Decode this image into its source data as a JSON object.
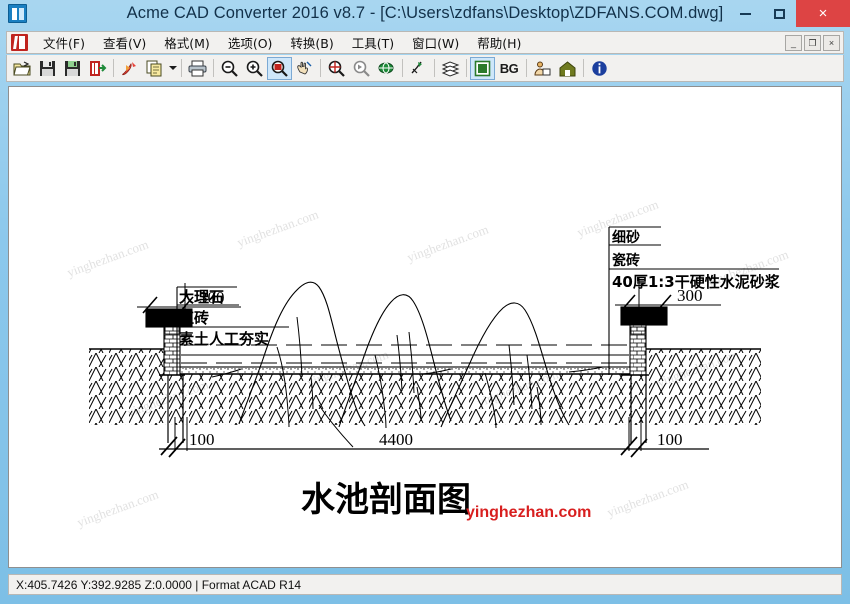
{
  "window": {
    "title": "Acme CAD Converter 2016 v8.7 - [C:\\Users\\zdfans\\Desktop\\ZDFANS.COM.dwg]",
    "icon": "app-icon",
    "buttons": {
      "minimize": "minimize",
      "maximize": "maximize",
      "close": "×"
    }
  },
  "menubar": {
    "logo": "acme-logo",
    "items": [
      {
        "label": "文件(F)",
        "name": "file"
      },
      {
        "label": "查看(V)",
        "name": "view"
      },
      {
        "label": "格式(M)",
        "name": "format"
      },
      {
        "label": "选项(O)",
        "name": "options"
      },
      {
        "label": "转换(B)",
        "name": "convert"
      },
      {
        "label": "工具(T)",
        "name": "tools"
      },
      {
        "label": "窗口(W)",
        "name": "window"
      },
      {
        "label": "帮助(H)",
        "name": "help"
      }
    ],
    "mdi_buttons": [
      "_",
      "❐",
      "×"
    ]
  },
  "toolbar": {
    "items": [
      {
        "name": "open-icon",
        "kind": "icon"
      },
      {
        "name": "save-icon",
        "kind": "icon"
      },
      {
        "name": "save-as-icon",
        "kind": "icon"
      },
      {
        "name": "batch-convert-icon",
        "kind": "icon"
      },
      {
        "name": "separator",
        "kind": "sep"
      },
      {
        "name": "pdf-export-icon",
        "kind": "icon"
      },
      {
        "name": "copy-icon",
        "kind": "icon"
      },
      {
        "name": "dropdown-arrow-icon",
        "kind": "arrow"
      },
      {
        "name": "separator",
        "kind": "sep"
      },
      {
        "name": "print-icon",
        "kind": "icon"
      },
      {
        "name": "separator",
        "kind": "sep"
      },
      {
        "name": "zoom-out-icon",
        "kind": "icon"
      },
      {
        "name": "zoom-in-icon",
        "kind": "icon"
      },
      {
        "name": "zoom-window-icon",
        "kind": "icon",
        "active": true
      },
      {
        "name": "pan-icon",
        "kind": "icon"
      },
      {
        "name": "separator",
        "kind": "sep"
      },
      {
        "name": "zoom-extents-icon",
        "kind": "icon"
      },
      {
        "name": "zoom-previous-icon",
        "kind": "icon"
      },
      {
        "name": "zoom-all-icon",
        "kind": "icon"
      },
      {
        "name": "separator",
        "kind": "sep"
      },
      {
        "name": "measure-icon",
        "kind": "icon"
      },
      {
        "name": "separator",
        "kind": "sep"
      },
      {
        "name": "layers-icon",
        "kind": "icon"
      },
      {
        "name": "separator",
        "kind": "sep"
      },
      {
        "name": "display-mode-icon",
        "kind": "icon",
        "active": true
      },
      {
        "name": "background-toggle",
        "kind": "text",
        "label": "BG"
      },
      {
        "name": "separator",
        "kind": "sep"
      },
      {
        "name": "register-icon",
        "kind": "icon"
      },
      {
        "name": "home-icon",
        "kind": "icon"
      },
      {
        "name": "separator",
        "kind": "sep"
      },
      {
        "name": "about-icon",
        "kind": "icon"
      }
    ]
  },
  "drawing": {
    "title": "水池剖面图",
    "watermark_red": "yinghezhan.com",
    "watermark_gray": "yinghezhan.com",
    "labels_left": [
      "大理石",
      "红砖",
      "素土人工夯实"
    ],
    "labels_right": [
      "细砂",
      "瓷砖",
      "40厚1:3干硬性水泥砂浆"
    ],
    "dim_left_top": "300",
    "dim_right_top": "300",
    "dim_bottom_left": "100",
    "dim_bottom_center": "4400",
    "dim_bottom_right": "100",
    "ink": "#000000",
    "paper": "#ffffff"
  },
  "statusbar": {
    "text": "X:405.7426 Y:392.9285 Z:0.0000 | Format ACAD R14"
  }
}
